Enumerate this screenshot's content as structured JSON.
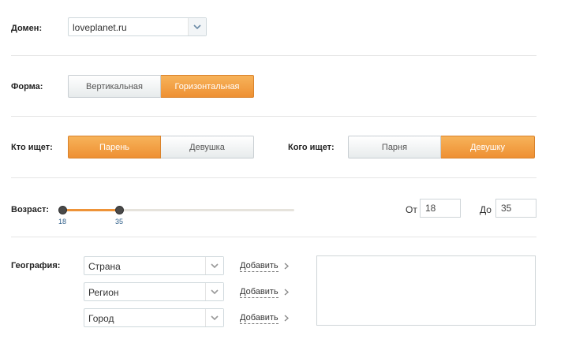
{
  "domain_section": {
    "label": "Домен:",
    "value": "loveplanet.ru"
  },
  "form_section": {
    "label": "Форма:",
    "options": [
      "Вертикальная",
      "Горизонтальная"
    ],
    "selected": "Горизонтальная"
  },
  "who_seeks": {
    "label": "Кто ищет:",
    "options": [
      "Парень",
      "Девушка"
    ],
    "selected": "Парень"
  },
  "whom_seeks": {
    "label": "Кого ищет:",
    "options": [
      "Парня",
      "Девушку"
    ],
    "selected": "Девушку"
  },
  "age": {
    "label": "Возраст:",
    "min_value": "18",
    "max_value": "35",
    "from_label": "От",
    "to_label": "До",
    "from_value": "18",
    "to_value": "35"
  },
  "geography": {
    "label": "География:",
    "fields": [
      {
        "value": "Страна",
        "add_label": "Добавить"
      },
      {
        "value": "Регион",
        "add_label": "Добавить"
      },
      {
        "value": "Город",
        "add_label": "Добавить"
      }
    ]
  },
  "colors": {
    "accent": "#ee9033",
    "link": "#2f5f8a"
  },
  "icons": {
    "select_arrow": "chevron-down-icon",
    "add_arrow": "chevron-right-icon"
  }
}
